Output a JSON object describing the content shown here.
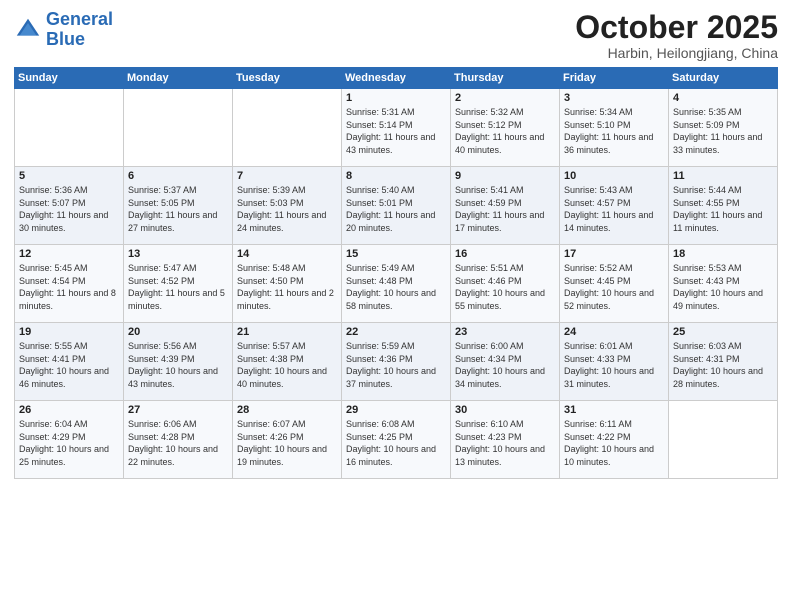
{
  "header": {
    "logo_line1": "General",
    "logo_line2": "Blue",
    "month_title": "October 2025",
    "location": "Harbin, Heilongjiang, China"
  },
  "weekdays": [
    "Sunday",
    "Monday",
    "Tuesday",
    "Wednesday",
    "Thursday",
    "Friday",
    "Saturday"
  ],
  "weeks": [
    [
      {
        "day": "",
        "info": ""
      },
      {
        "day": "",
        "info": ""
      },
      {
        "day": "",
        "info": ""
      },
      {
        "day": "1",
        "info": "Sunrise: 5:31 AM\nSunset: 5:14 PM\nDaylight: 11 hours\nand 43 minutes."
      },
      {
        "day": "2",
        "info": "Sunrise: 5:32 AM\nSunset: 5:12 PM\nDaylight: 11 hours\nand 40 minutes."
      },
      {
        "day": "3",
        "info": "Sunrise: 5:34 AM\nSunset: 5:10 PM\nDaylight: 11 hours\nand 36 minutes."
      },
      {
        "day": "4",
        "info": "Sunrise: 5:35 AM\nSunset: 5:09 PM\nDaylight: 11 hours\nand 33 minutes."
      }
    ],
    [
      {
        "day": "5",
        "info": "Sunrise: 5:36 AM\nSunset: 5:07 PM\nDaylight: 11 hours\nand 30 minutes."
      },
      {
        "day": "6",
        "info": "Sunrise: 5:37 AM\nSunset: 5:05 PM\nDaylight: 11 hours\nand 27 minutes."
      },
      {
        "day": "7",
        "info": "Sunrise: 5:39 AM\nSunset: 5:03 PM\nDaylight: 11 hours\nand 24 minutes."
      },
      {
        "day": "8",
        "info": "Sunrise: 5:40 AM\nSunset: 5:01 PM\nDaylight: 11 hours\nand 20 minutes."
      },
      {
        "day": "9",
        "info": "Sunrise: 5:41 AM\nSunset: 4:59 PM\nDaylight: 11 hours\nand 17 minutes."
      },
      {
        "day": "10",
        "info": "Sunrise: 5:43 AM\nSunset: 4:57 PM\nDaylight: 11 hours\nand 14 minutes."
      },
      {
        "day": "11",
        "info": "Sunrise: 5:44 AM\nSunset: 4:55 PM\nDaylight: 11 hours\nand 11 minutes."
      }
    ],
    [
      {
        "day": "12",
        "info": "Sunrise: 5:45 AM\nSunset: 4:54 PM\nDaylight: 11 hours\nand 8 minutes."
      },
      {
        "day": "13",
        "info": "Sunrise: 5:47 AM\nSunset: 4:52 PM\nDaylight: 11 hours\nand 5 minutes."
      },
      {
        "day": "14",
        "info": "Sunrise: 5:48 AM\nSunset: 4:50 PM\nDaylight: 11 hours\nand 2 minutes."
      },
      {
        "day": "15",
        "info": "Sunrise: 5:49 AM\nSunset: 4:48 PM\nDaylight: 10 hours\nand 58 minutes."
      },
      {
        "day": "16",
        "info": "Sunrise: 5:51 AM\nSunset: 4:46 PM\nDaylight: 10 hours\nand 55 minutes."
      },
      {
        "day": "17",
        "info": "Sunrise: 5:52 AM\nSunset: 4:45 PM\nDaylight: 10 hours\nand 52 minutes."
      },
      {
        "day": "18",
        "info": "Sunrise: 5:53 AM\nSunset: 4:43 PM\nDaylight: 10 hours\nand 49 minutes."
      }
    ],
    [
      {
        "day": "19",
        "info": "Sunrise: 5:55 AM\nSunset: 4:41 PM\nDaylight: 10 hours\nand 46 minutes."
      },
      {
        "day": "20",
        "info": "Sunrise: 5:56 AM\nSunset: 4:39 PM\nDaylight: 10 hours\nand 43 minutes."
      },
      {
        "day": "21",
        "info": "Sunrise: 5:57 AM\nSunset: 4:38 PM\nDaylight: 10 hours\nand 40 minutes."
      },
      {
        "day": "22",
        "info": "Sunrise: 5:59 AM\nSunset: 4:36 PM\nDaylight: 10 hours\nand 37 minutes."
      },
      {
        "day": "23",
        "info": "Sunrise: 6:00 AM\nSunset: 4:34 PM\nDaylight: 10 hours\nand 34 minutes."
      },
      {
        "day": "24",
        "info": "Sunrise: 6:01 AM\nSunset: 4:33 PM\nDaylight: 10 hours\nand 31 minutes."
      },
      {
        "day": "25",
        "info": "Sunrise: 6:03 AM\nSunset: 4:31 PM\nDaylight: 10 hours\nand 28 minutes."
      }
    ],
    [
      {
        "day": "26",
        "info": "Sunrise: 6:04 AM\nSunset: 4:29 PM\nDaylight: 10 hours\nand 25 minutes."
      },
      {
        "day": "27",
        "info": "Sunrise: 6:06 AM\nSunset: 4:28 PM\nDaylight: 10 hours\nand 22 minutes."
      },
      {
        "day": "28",
        "info": "Sunrise: 6:07 AM\nSunset: 4:26 PM\nDaylight: 10 hours\nand 19 minutes."
      },
      {
        "day": "29",
        "info": "Sunrise: 6:08 AM\nSunset: 4:25 PM\nDaylight: 10 hours\nand 16 minutes."
      },
      {
        "day": "30",
        "info": "Sunrise: 6:10 AM\nSunset: 4:23 PM\nDaylight: 10 hours\nand 13 minutes."
      },
      {
        "day": "31",
        "info": "Sunrise: 6:11 AM\nSunset: 4:22 PM\nDaylight: 10 hours\nand 10 minutes."
      },
      {
        "day": "",
        "info": ""
      }
    ]
  ]
}
